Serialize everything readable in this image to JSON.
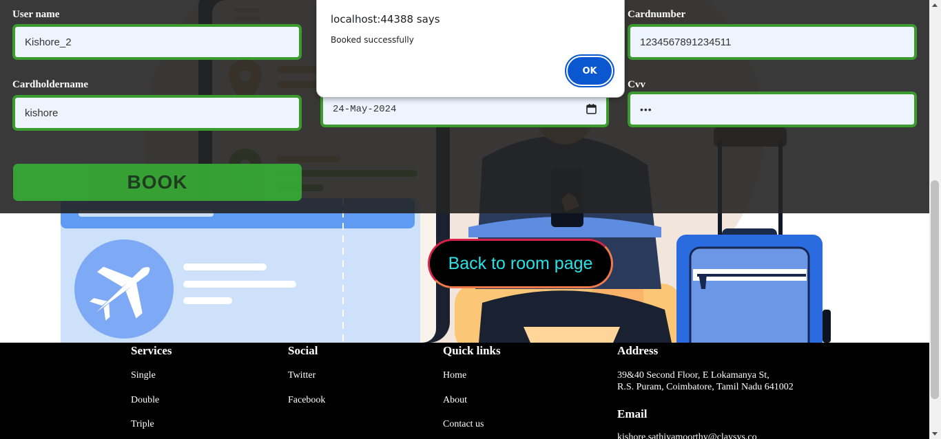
{
  "form": {
    "username_label": "User name",
    "username_value": "Kishore_2",
    "cardnumber_label": "Cardnumber",
    "cardnumber_value": "1234567891234511",
    "cardholder_label": "Cardholdername",
    "cardholder_value": "kishore",
    "date_value": "24-May-2024",
    "cvv_label": "Cvv",
    "cvv_value": "•••",
    "book_label": "BOOK"
  },
  "back_button_label": "Back to room page",
  "dialog": {
    "title": "localhost:44388 says",
    "message": "Booked successfully",
    "ok_label": "OK"
  },
  "footer": {
    "services": {
      "heading": "Services",
      "items": [
        "Single",
        "Double",
        "Triple"
      ]
    },
    "social": {
      "heading": "Social",
      "items": [
        "Twitter",
        "Facebook"
      ]
    },
    "quick_links": {
      "heading": "Quick links",
      "items": [
        "Home",
        "About",
        "Contact us"
      ]
    },
    "address": {
      "heading": "Address",
      "line1": "39&40 Second Floor, E Lokamanya St,",
      "line2": "R.S. Puram, Coimbatore, Tamil Nadu 641002"
    },
    "email": {
      "heading": "Email",
      "value": "kishore.sathiyamoorthy@claysys.co"
    }
  },
  "icons": {
    "calendar": "calendar-icon",
    "airplane": "airplane-icon",
    "map_pin": "map-pin-icon",
    "phone": "phone-icon",
    "luggage": "luggage-icon"
  },
  "colors": {
    "input_border": "#3b9b2e",
    "book_button": "#36a634",
    "dialog_ok": "#0b57d0",
    "back_button_text": "#27e3e8",
    "footer_bg": "#000000"
  }
}
